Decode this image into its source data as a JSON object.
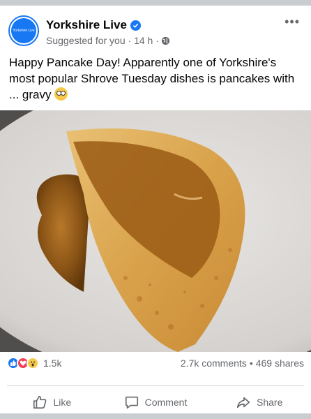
{
  "post": {
    "page_name": "Yorkshire Live",
    "avatar_text": "Yorkshire Live",
    "meta": "Suggested for you · 14 h ·",
    "text": "Happy Pancake Day! Apparently one of Yorkshire's most popular Shrove Tuesday dishes is pancakes with ... gravy",
    "accent": "#1877f2"
  },
  "reactions": {
    "count": "1.5k",
    "types": [
      "like",
      "love",
      "wow"
    ]
  },
  "stats": {
    "comments": "2.7k comments",
    "separator": "•",
    "shares": "469 shares"
  },
  "actions": {
    "like": "Like",
    "comment": "Comment",
    "share": "Share"
  }
}
